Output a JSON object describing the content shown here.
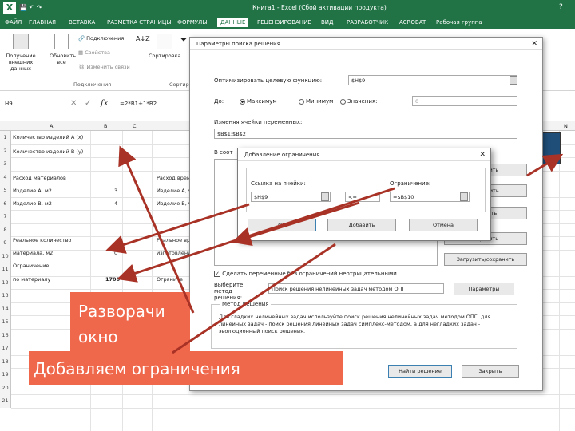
{
  "titlebar": {
    "title": "Книга1 - Excel (Сбой активации продукта)",
    "help": "?"
  },
  "ribbon_tabs": [
    "ФАЙЛ",
    "ГЛАВНАЯ",
    "ВСТАВКА",
    "РАЗМЕТКА СТРАНИЦЫ",
    "ФОРМУЛЫ",
    "ДАННЫЕ",
    "РЕЦЕНЗИРОВАНИЕ",
    "ВИД",
    "РАЗРАБОТЧИК",
    "ACROBAT",
    "Рабочая группа"
  ],
  "ribbon": {
    "get_external": "Получение внешних данных",
    "refresh_all": "Обновить все",
    "connections": "Подключения",
    "properties": "Свойства",
    "edit_links": "Изменить связи",
    "group_connections": "Подключения",
    "sort": "Сортировка",
    "filter": "Фильтр",
    "group_sort": "Сортир"
  },
  "formula": {
    "namebox": "H9",
    "fx": "fx",
    "value": "=2*B1+1*B2"
  },
  "columns": [
    "A",
    "B",
    "C",
    "N"
  ],
  "rows": [
    "1",
    "2",
    "3",
    "4",
    "5",
    "6",
    "7",
    "8",
    "9",
    "10",
    "11",
    "12",
    "13",
    "14",
    "15",
    "16",
    "17",
    "18",
    "19",
    "20",
    "21"
  ],
  "cells": {
    "a1": "Количество изделий А (x)",
    "a2": "Количество изделий В (y)",
    "a4": "Расход материалов",
    "a5": "Изделие А, м2",
    "b5": "3",
    "a6": "Изделие В, м2",
    "b6": "4",
    "a8": "Реальное количество",
    "a9": "материала, м2",
    "b9": "0",
    "a10a": "Ограничение",
    "a10": "по материалу",
    "b10": "1700",
    "c4": "Расход времени",
    "c5": "Изделие А, ч",
    "c6": "Изделие В, ч",
    "c8": "Реальное вре",
    "c9": "изготовления",
    "c10": "Ограниче"
  },
  "solver": {
    "title": "Параметры поиска решения",
    "objective_label": "Оптимизировать целевую функцию:",
    "objective_value": "$H$9",
    "to_label": "До:",
    "max": "Максимум",
    "min": "Минимум",
    "value_of": "Значения:",
    "value_field": "0",
    "changing_label": "Изменяя ячейки переменных:",
    "changing_value": "$B$1:$B$2",
    "subject_label": "В соот",
    "btn_add": "Добавить",
    "btn_change": "Изменить",
    "btn_delete": "Удалить",
    "btn_reset": "Сбросить",
    "btn_loadsave": "Загрузить/сохранить",
    "nonneg": "Сделать переменные без ограничений неотрицательными",
    "method_label": "Выберите метод решения:",
    "method_value": "Поиск решения нелинейных задач методом ОПГ",
    "btn_options": "Параметры",
    "method_group": "Метод решения",
    "method_desc": "Для гладких нелинейных задач используйте поиск решения нелинейных задач методом ОПГ, для линейных задач - поиск решения линейных задач симплекс-методом, а для негладких задач - эволюционный поиск решения.",
    "btn_solve": "Найти решение",
    "btn_close": "Закрыть"
  },
  "constraint": {
    "title": "Добавление ограничения",
    "cell_ref_label": "Ссылка на ячейки:",
    "cell_ref_value": "$H$9",
    "operator": "<=",
    "constraint_label": "Ограничение:",
    "constraint_value": "=$B$10",
    "btn_ok": "ОК",
    "btn_add": "Добавить",
    "btn_cancel": "Отмена"
  },
  "captions": {
    "line1": "Разворачи",
    "line2": "окно",
    "line3": "Добавляем ограничения"
  },
  "colors": {
    "excel_green": "#217346",
    "caption_bg": "#f0684c",
    "arrow": "#a93226"
  }
}
